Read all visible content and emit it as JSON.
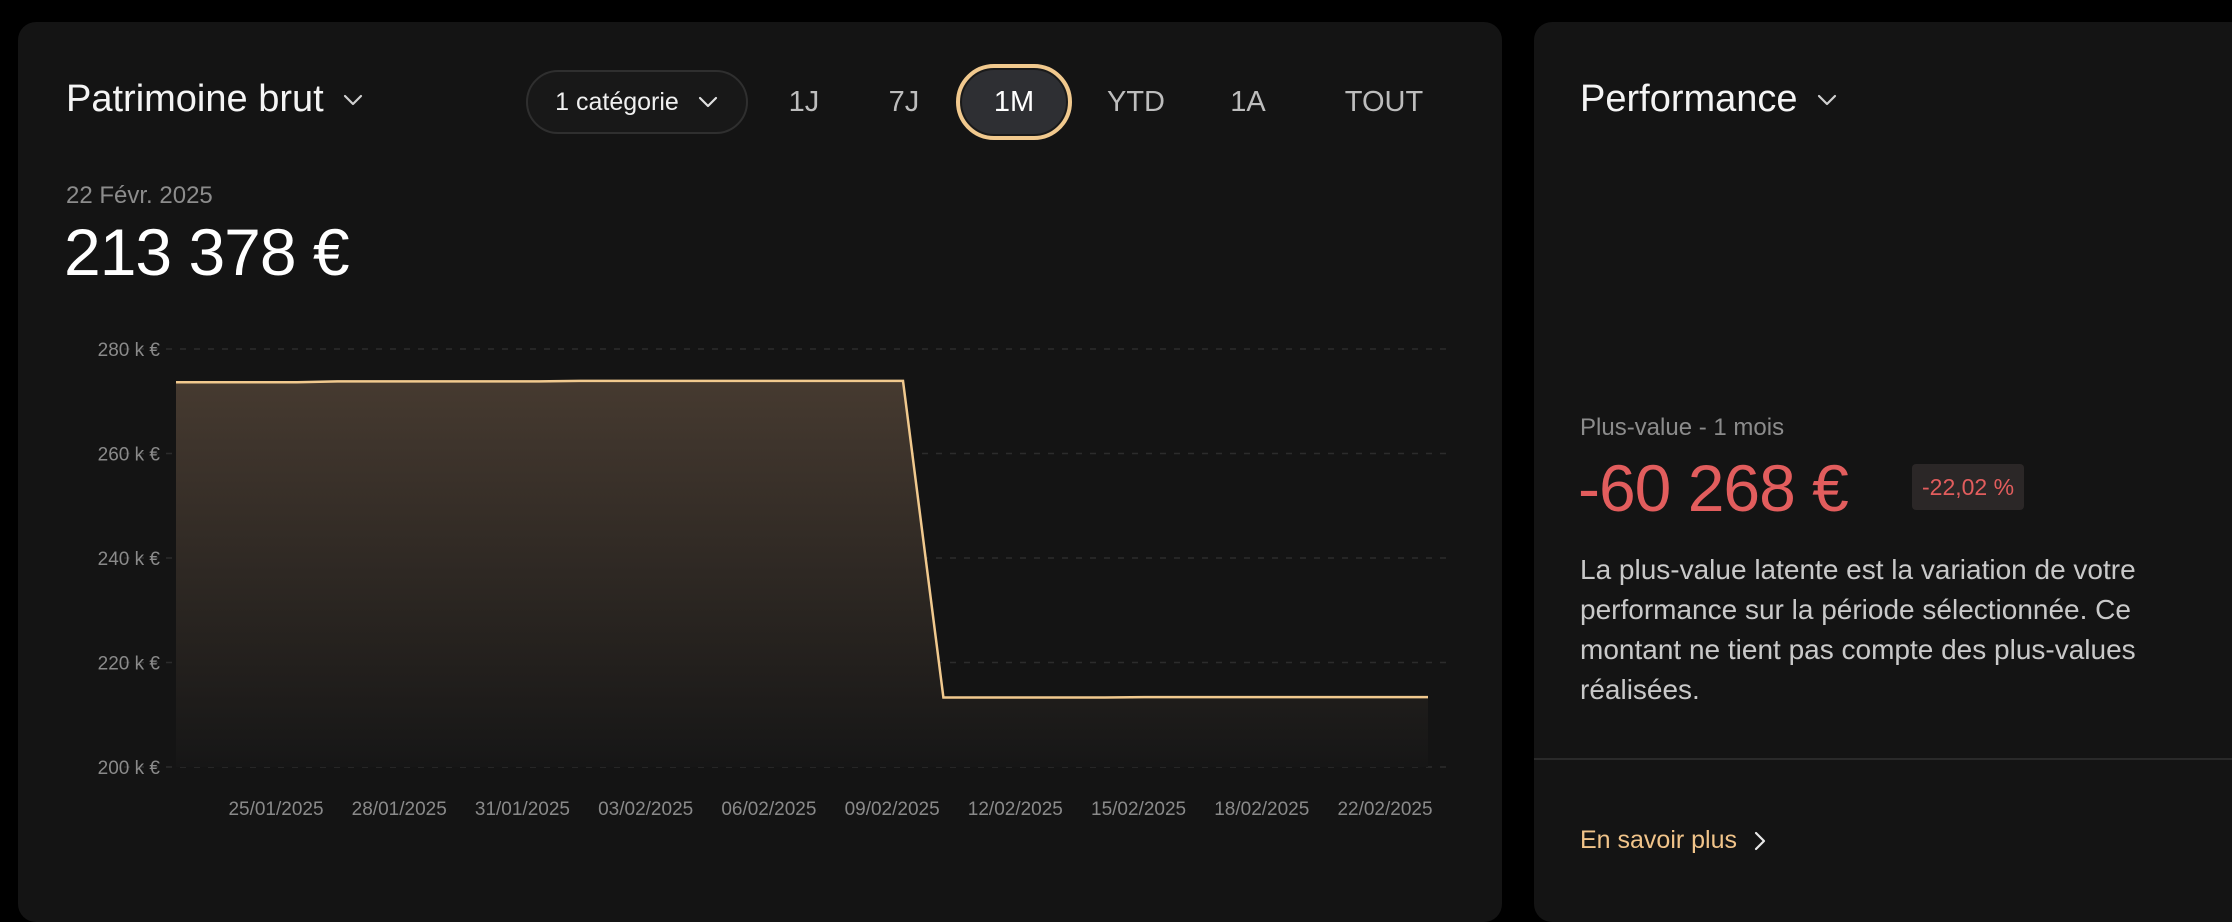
{
  "left_panel": {
    "title": "Patrimoine brut",
    "category_button": "1 catégorie",
    "ranges": [
      {
        "label": "1J",
        "active": false
      },
      {
        "label": "7J",
        "active": false
      },
      {
        "label": "1M",
        "active": true
      },
      {
        "label": "YTD",
        "active": false
      },
      {
        "label": "1A",
        "active": false
      },
      {
        "label": "TOUT",
        "active": false
      }
    ],
    "selected_date": "22 Févr. 2025",
    "value": "213 378 €"
  },
  "right_panel": {
    "title": "Performance",
    "gain_label": "Plus-value - 1 mois",
    "gain_value": "-60 268 €",
    "gain_percent": "-22,02 %",
    "description": "La plus-value latente est la variation de votre performance sur la période sélectionnée. Ce montant ne tient pas compte des plus-values réalisées.",
    "learn_more": "En savoir plus"
  },
  "colors": {
    "accent": "#f1c98e",
    "negative": "#e25d5d",
    "panel_bg": "#141414"
  },
  "chart_data": {
    "type": "area",
    "x_ticks": [
      "25/01/2025",
      "28/01/2025",
      "31/01/2025",
      "03/02/2025",
      "06/02/2025",
      "09/02/2025",
      "12/02/2025",
      "15/02/2025",
      "18/02/2025",
      "22/02/2025"
    ],
    "y_ticks": [
      "280 k €",
      "260 k €",
      "240 k €",
      "220 k €",
      "200 k €"
    ],
    "ylim": [
      200000,
      280000
    ],
    "xlim": [
      "2025-01-23",
      "2025-02-23"
    ],
    "series": [
      {
        "points": [
          {
            "x": "2025-01-23",
            "y": 273650
          },
          {
            "x": "2025-01-26",
            "y": 273650
          },
          {
            "x": "2025-01-27",
            "y": 273800
          },
          {
            "x": "2025-02-01",
            "y": 273800
          },
          {
            "x": "2025-02-02",
            "y": 273900
          },
          {
            "x": "2025-02-10",
            "y": 273900
          },
          {
            "x": "2025-02-11",
            "y": 213300
          },
          {
            "x": "2025-02-15",
            "y": 213300
          },
          {
            "x": "2025-02-16",
            "y": 213378
          },
          {
            "x": "2025-02-23",
            "y": 213378
          }
        ]
      }
    ],
    "grid": true,
    "legend": "none"
  }
}
